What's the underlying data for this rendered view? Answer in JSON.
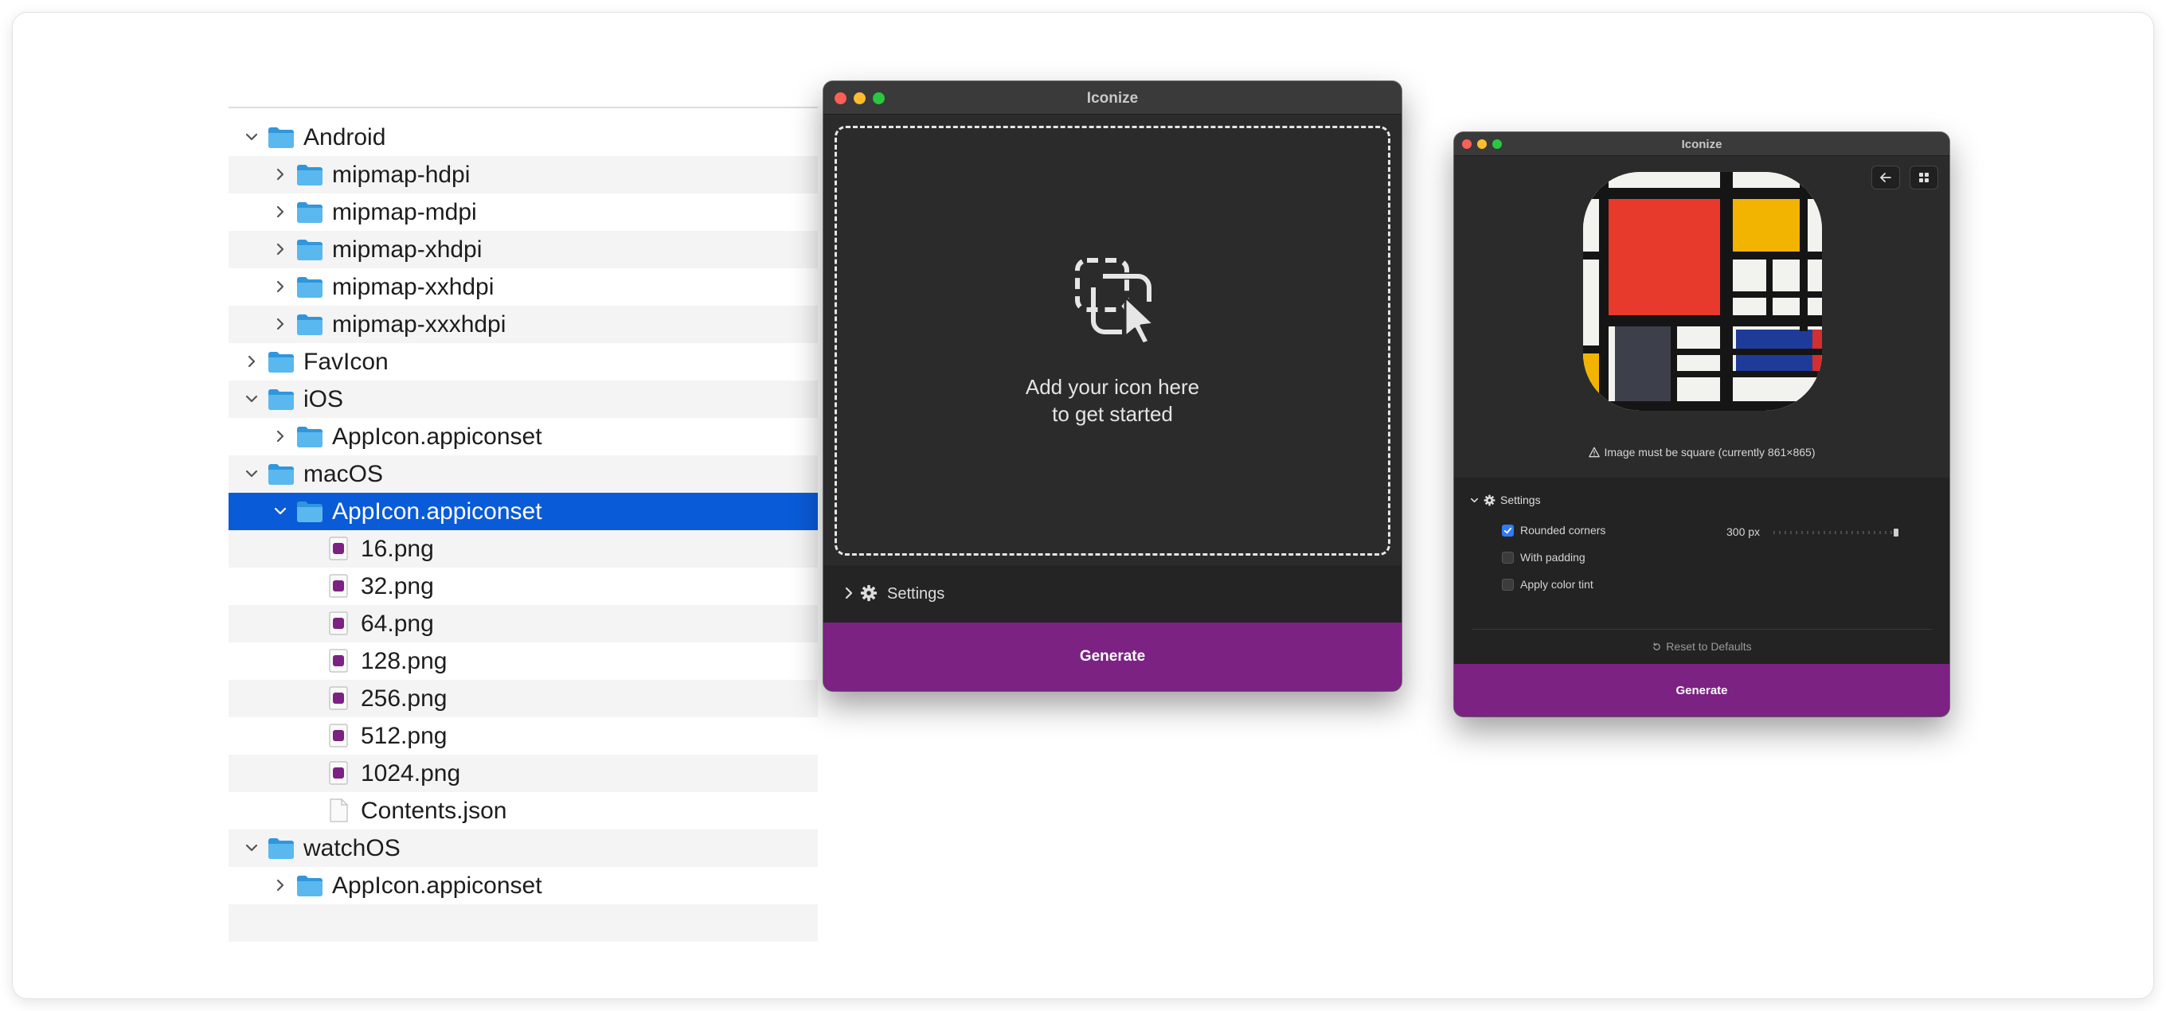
{
  "finder": {
    "rows": [
      {
        "name": "Android",
        "type": "folder",
        "expanded": true
      },
      {
        "name": "mipmap-hdpi",
        "type": "folder",
        "expanded": false
      },
      {
        "name": "mipmap-mdpi",
        "type": "folder",
        "expanded": false
      },
      {
        "name": "mipmap-xhdpi",
        "type": "folder",
        "expanded": false
      },
      {
        "name": "mipmap-xxhdpi",
        "type": "folder",
        "expanded": false
      },
      {
        "name": "mipmap-xxxhdpi",
        "type": "folder",
        "expanded": false
      },
      {
        "name": "FavIcon",
        "type": "folder",
        "expanded": false
      },
      {
        "name": "iOS",
        "type": "folder",
        "expanded": true
      },
      {
        "name": "AppIcon.appiconset",
        "type": "folder",
        "expanded": false
      },
      {
        "name": "macOS",
        "type": "folder",
        "expanded": true
      },
      {
        "name": "AppIcon.appiconset",
        "type": "folder",
        "expanded": true,
        "selected": true
      },
      {
        "name": "16.png",
        "type": "png"
      },
      {
        "name": "32.png",
        "type": "png"
      },
      {
        "name": "64.png",
        "type": "png"
      },
      {
        "name": "128.png",
        "type": "png"
      },
      {
        "name": "256.png",
        "type": "png"
      },
      {
        "name": "512.png",
        "type": "png"
      },
      {
        "name": "1024.png",
        "type": "png"
      },
      {
        "name": "Contents.json",
        "type": "file"
      },
      {
        "name": "watchOS",
        "type": "folder",
        "expanded": true
      },
      {
        "name": "AppIcon.appiconset",
        "type": "folder",
        "expanded": false
      },
      {
        "name": "",
        "type": "empty"
      }
    ],
    "colors": {
      "selection": "#0a5bd7",
      "folder": "#3ea8e8",
      "png": "#7b2283"
    }
  },
  "window_empty": {
    "title": "Iconize",
    "drop_line1": "Add your icon here",
    "drop_line2": "to get started",
    "settings_label": "Settings",
    "generate_label": "Generate"
  },
  "window_loaded": {
    "title": "Iconize",
    "warning": "Image must be square (currently 861×865)",
    "settings_label": "Settings",
    "options": [
      {
        "label": "Rounded corners",
        "checked": true
      },
      {
        "label": "With padding",
        "checked": false
      },
      {
        "label": "Apply color tint",
        "checked": false
      }
    ],
    "corner_radius": "300 px",
    "reset_label": "Reset to Defaults",
    "generate_label": "Generate",
    "accent": "#7b2283"
  }
}
